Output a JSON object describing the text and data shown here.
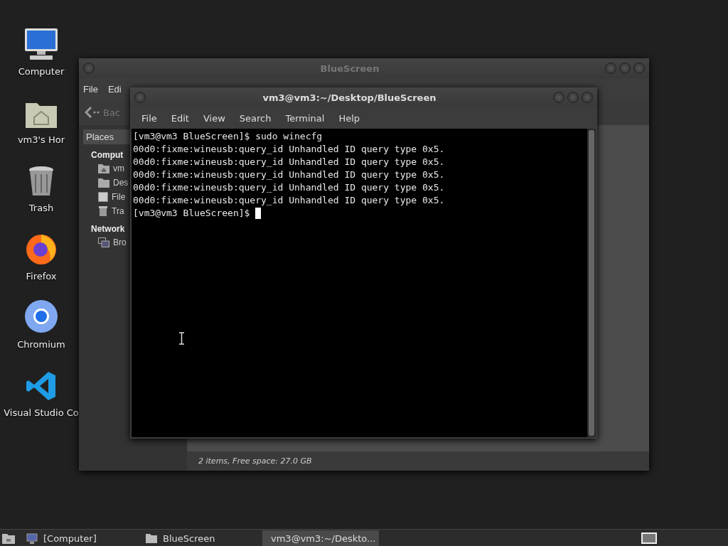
{
  "desktop_icons": [
    {
      "label": "Computer",
      "kind": "computer"
    },
    {
      "label": "vm3's Hor",
      "kind": "home"
    },
    {
      "label": "Trash",
      "kind": "trash"
    },
    {
      "label": "Firefox",
      "kind": "firefox"
    },
    {
      "label": "Chromium",
      "kind": "chromium"
    },
    {
      "label": "Visual Studio Co",
      "kind": "vscode"
    }
  ],
  "file_manager": {
    "title": "BlueScreen",
    "menu": [
      "File",
      "Edi"
    ],
    "back_button": "Bac",
    "sidebar": {
      "tab": "Places",
      "sections": [
        {
          "heading": "Comput",
          "items": [
            {
              "label": "vm",
              "kind": "home"
            },
            {
              "label": "Des",
              "kind": "desktop"
            },
            {
              "label": "File",
              "kind": "drive"
            },
            {
              "label": "Tra",
              "kind": "trash"
            }
          ]
        },
        {
          "heading": "Network",
          "items": [
            {
              "label": "Bro",
              "kind": "network"
            }
          ]
        }
      ]
    },
    "status_bar": "2 items, Free space: 27.0 GB"
  },
  "terminal": {
    "title": "vm3@vm3:~/Desktop/BlueScreen",
    "menu": [
      "File",
      "Edit",
      "View",
      "Search",
      "Terminal",
      "Help"
    ],
    "lines": [
      "[vm3@vm3 BlueScreen]$ sudo winecfg",
      "00d0:fixme:wineusb:query_id Unhandled ID query type 0x5.",
      "00d0:fixme:wineusb:query_id Unhandled ID query type 0x5.",
      "00d0:fixme:wineusb:query_id Unhandled ID query type 0x5.",
      "00d0:fixme:wineusb:query_id Unhandled ID query type 0x5.",
      "00d0:fixme:wineusb:query_id Unhandled ID query type 0x5."
    ],
    "prompt": "[vm3@vm3 BlueScreen]$"
  },
  "taskbar": {
    "items": [
      {
        "label": "[Computer]",
        "kind": "computer",
        "selected": false
      },
      {
        "label": "BlueScreen",
        "kind": "folder",
        "selected": false
      },
      {
        "label": "vm3@vm3:~/Deskto...",
        "kind": "terminal",
        "selected": true
      }
    ]
  }
}
